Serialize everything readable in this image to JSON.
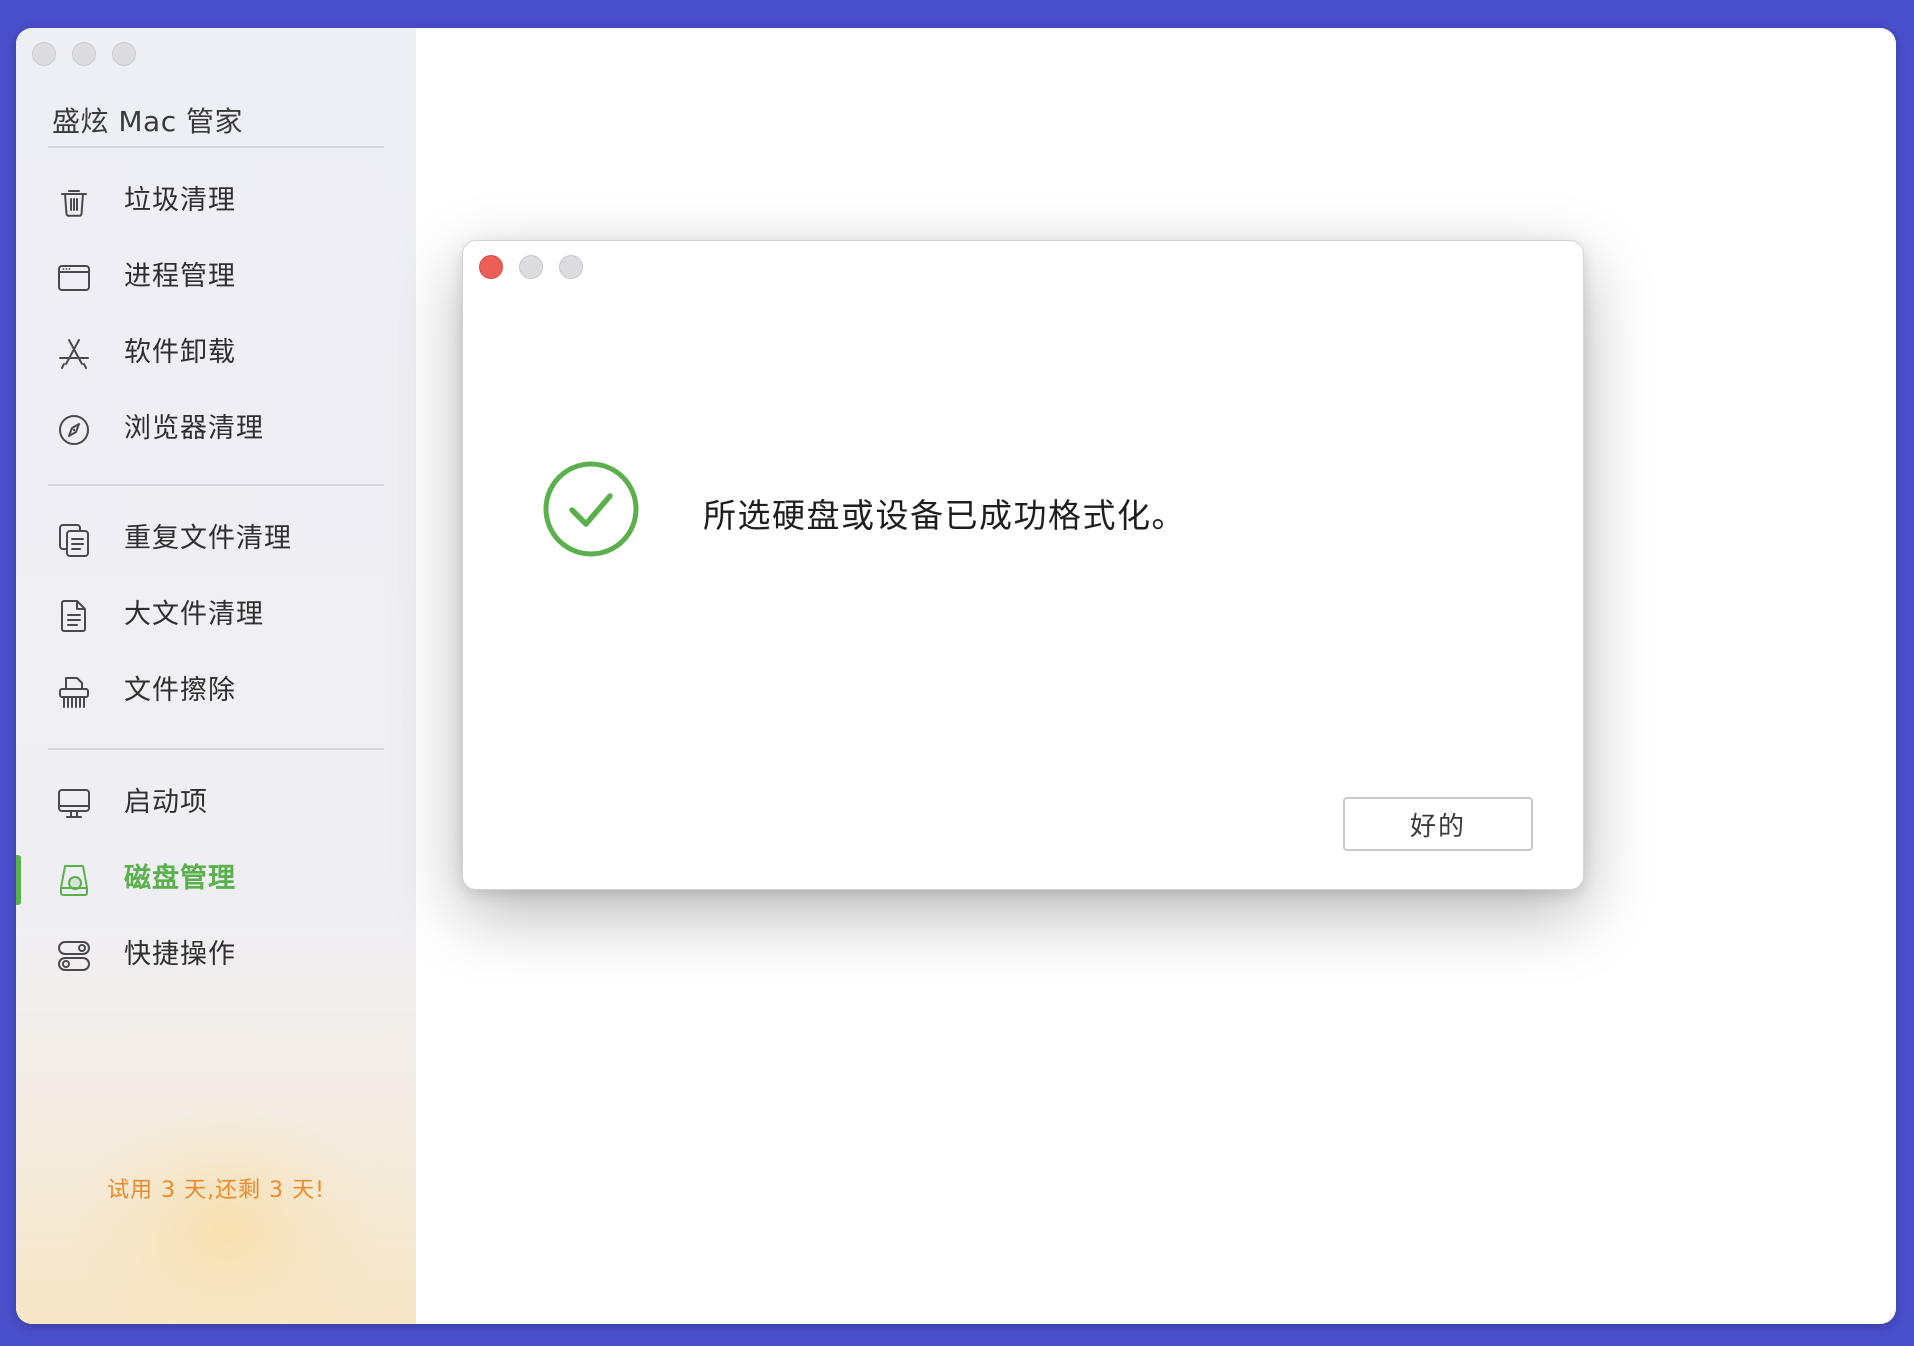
{
  "app": {
    "title": "盛炫 Mac 管家"
  },
  "sidebar": {
    "items": [
      {
        "label": "垃圾清理",
        "icon": "trash-icon"
      },
      {
        "label": "进程管理",
        "icon": "window-icon"
      },
      {
        "label": "软件卸载",
        "icon": "app-store-icon"
      },
      {
        "label": "浏览器清理",
        "icon": "compass-icon"
      },
      {
        "label": "重复文件清理",
        "icon": "duplicate-files-icon"
      },
      {
        "label": "大文件清理",
        "icon": "document-icon"
      },
      {
        "label": "文件擦除",
        "icon": "shredder-icon"
      },
      {
        "label": "启动项",
        "icon": "monitor-icon"
      },
      {
        "label": "磁盘管理",
        "icon": "disk-icon",
        "active": true
      },
      {
        "label": "快捷操作",
        "icon": "toggles-icon"
      }
    ],
    "trial_text": "试用 3 天,还剩 3 天!"
  },
  "dialog": {
    "message": "所选硬盘或设备已成功格式化。",
    "ok_label": "好的",
    "status_icon": "success-check-icon"
  },
  "colors": {
    "accent_green": "#5ab14c",
    "trial_orange": "#e98a2c",
    "close_red": "#ec5f56",
    "desktop_bg": "#4a4fcc"
  }
}
